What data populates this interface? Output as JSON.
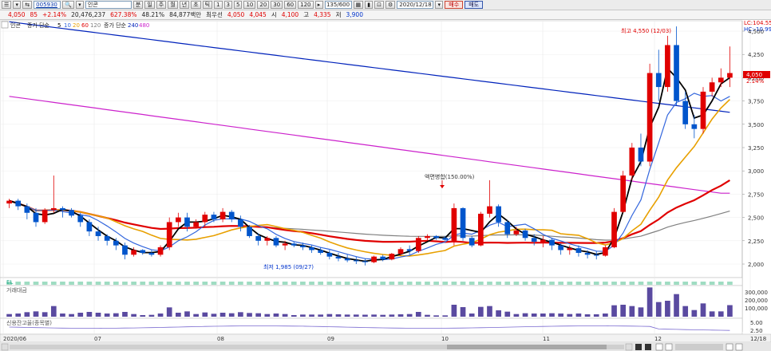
{
  "toolbar": {
    "stock_code": "005930",
    "stock_name": "인콘",
    "count": "135/600",
    "date": "2020/12/18",
    "period_buttons": [
      "1",
      "3",
      "5",
      "10",
      "20",
      "30",
      "60",
      "120"
    ],
    "period_tabs": [
      "분",
      "일",
      "주",
      "월",
      "년",
      "초",
      "틱"
    ],
    "buy": "매수",
    "sell": "매도"
  },
  "quote": {
    "price": "4,050",
    "change": "85",
    "rate": "+2.14%",
    "volume": "20,476,237",
    "turnover": "627.38%",
    "ratio": "48.21%",
    "amount": "84,877백만",
    "best_ask_label": "최우선",
    "best_ask": "4,050",
    "best_bid": "4,045",
    "open_label": "시",
    "open": "4,100",
    "high_label": "고",
    "high": "4,335",
    "low_label": "저",
    "low": "3,900"
  },
  "legend": {
    "name": "인콘",
    "ma_prefix": "증가 단순",
    "ma_periods": [
      "5",
      "10",
      "20",
      "60",
      "120"
    ],
    "ma_colors": [
      "#000000",
      "#3366dd",
      "#e8a000",
      "#e00000",
      "#808080"
    ],
    "long_prefix": "증가 단순",
    "long_periods": [
      "240",
      "480"
    ],
    "long_colors": [
      "#0022bb",
      "#cc22cc"
    ]
  },
  "right_labels": {
    "lc": "LC:104.55",
    "hc": "HC:-10.99",
    "price_tag": "4,050",
    "pct_tag": "2.14%"
  },
  "annotations": {
    "high": "최고 4,550 (12/03)",
    "low": "최저 1,985 (09/27)",
    "event": "액면병합(150.00%)"
  },
  "panes": {
    "volume_label": "거래대금",
    "credit_label": "신용잔고율(종목별)",
    "small_label": "EL"
  },
  "chart_data": {
    "type": "candlestick",
    "y_ticks": [
      "4,500",
      "4,250",
      "4,000",
      "3,750",
      "3,500",
      "3,250",
      "3,000",
      "2,750",
      "2,500",
      "2,250",
      "2,000"
    ],
    "volume_ticks": [
      "300,000",
      "200,000",
      "100,000"
    ],
    "credit_ticks": [
      "5.00",
      "2.50"
    ],
    "x_labels": [
      "2020/06",
      "07",
      "08",
      "09",
      "10",
      "11",
      "12",
      "12/18"
    ],
    "candles": [
      [
        2650,
        2700,
        2600,
        2680
      ],
      [
        2680,
        2700,
        2580,
        2620
      ],
      [
        2620,
        2650,
        2480,
        2550
      ],
      [
        2550,
        2600,
        2400,
        2450
      ],
      [
        2450,
        2600,
        2430,
        2580
      ],
      [
        2580,
        2950,
        2550,
        2600
      ],
      [
        2600,
        2620,
        2500,
        2580
      ],
      [
        2580,
        2600,
        2500,
        2520
      ],
      [
        2520,
        2550,
        2400,
        2450
      ],
      [
        2450,
        2480,
        2300,
        2350
      ],
      [
        2350,
        2400,
        2250,
        2300
      ],
      [
        2300,
        2320,
        2200,
        2250
      ],
      [
        2250,
        2280,
        2150,
        2200
      ],
      [
        2200,
        2230,
        2050,
        2100
      ],
      [
        2100,
        2180,
        2080,
        2150
      ],
      [
        2150,
        2160,
        2100,
        2120
      ],
      [
        2120,
        2150,
        2080,
        2100
      ],
      [
        2100,
        2200,
        2080,
        2180
      ],
      [
        2180,
        2500,
        2150,
        2450
      ],
      [
        2450,
        2550,
        2400,
        2500
      ],
      [
        2500,
        2550,
        2350,
        2400
      ],
      [
        2400,
        2480,
        2380,
        2450
      ],
      [
        2450,
        2560,
        2400,
        2530
      ],
      [
        2530,
        2560,
        2450,
        2480
      ],
      [
        2480,
        2600,
        2450,
        2560
      ],
      [
        2560,
        2580,
        2450,
        2480
      ],
      [
        2480,
        2520,
        2350,
        2400
      ],
      [
        2400,
        2420,
        2280,
        2300
      ],
      [
        2300,
        2330,
        2200,
        2250
      ],
      [
        2250,
        2300,
        2200,
        2280
      ],
      [
        2280,
        2300,
        2180,
        2200
      ],
      [
        2200,
        2250,
        2150,
        2220
      ],
      [
        2220,
        2240,
        2180,
        2200
      ],
      [
        2200,
        2230,
        2150,
        2180
      ],
      [
        2180,
        2200,
        2120,
        2150
      ],
      [
        2150,
        2180,
        2100,
        2120
      ],
      [
        2120,
        2150,
        2050,
        2080
      ],
      [
        2080,
        2120,
        2030,
        2060
      ],
      [
        2060,
        2100,
        2020,
        2040
      ],
      [
        2040,
        2080,
        2000,
        2030
      ],
      [
        2030,
        2060,
        1985,
        2020
      ],
      [
        2020,
        2090,
        2010,
        2080
      ],
      [
        2080,
        2100,
        2030,
        2050
      ],
      [
        2050,
        2120,
        2040,
        2110
      ],
      [
        2110,
        2180,
        2090,
        2160
      ],
      [
        2160,
        2200,
        2100,
        2140
      ],
      [
        2140,
        2300,
        2120,
        2280
      ],
      [
        2280,
        2320,
        2250,
        2300
      ],
      [
        2300,
        2310,
        2260,
        2280
      ],
      [
        2280,
        2300,
        2250,
        2260
      ],
      [
        2250,
        2650,
        2200,
        2600
      ],
      [
        2600,
        2610,
        2250,
        2280
      ],
      [
        2280,
        2300,
        2180,
        2200
      ],
      [
        2200,
        2560,
        2190,
        2540
      ],
      [
        2540,
        2900,
        2500,
        2620
      ],
      [
        2620,
        2640,
        2400,
        2450
      ],
      [
        2450,
        2470,
        2280,
        2320
      ],
      [
        2320,
        2400,
        2300,
        2360
      ],
      [
        2360,
        2380,
        2250,
        2280
      ],
      [
        2280,
        2320,
        2200,
        2240
      ],
      [
        2240,
        2300,
        2180,
        2260
      ],
      [
        2260,
        2280,
        2150,
        2200
      ],
      [
        2200,
        2220,
        2100,
        2150
      ],
      [
        2150,
        2200,
        2100,
        2170
      ],
      [
        2170,
        2200,
        2080,
        2120
      ],
      [
        2120,
        2150,
        2060,
        2100
      ],
      [
        2100,
        2140,
        2050,
        2090
      ],
      [
        2090,
        2200,
        2080,
        2180
      ],
      [
        2180,
        2600,
        2170,
        2560
      ],
      [
        2560,
        3000,
        2550,
        2950
      ],
      [
        2950,
        3300,
        2900,
        3250
      ],
      [
        3250,
        3400,
        3050,
        3100
      ],
      [
        3100,
        4150,
        3050,
        4050
      ],
      [
        4050,
        4300,
        3750,
        3900
      ],
      [
        3900,
        4450,
        3850,
        4350
      ],
      [
        4350,
        4550,
        3700,
        3750
      ],
      [
        3750,
        3850,
        3450,
        3500
      ],
      [
        3500,
        3600,
        3350,
        3450
      ],
      [
        3450,
        3900,
        3400,
        3850
      ],
      [
        3850,
        4000,
        3800,
        3950
      ],
      [
        3950,
        4100,
        3900,
        4000
      ],
      [
        4000,
        4335,
        3900,
        4050
      ]
    ]
  }
}
